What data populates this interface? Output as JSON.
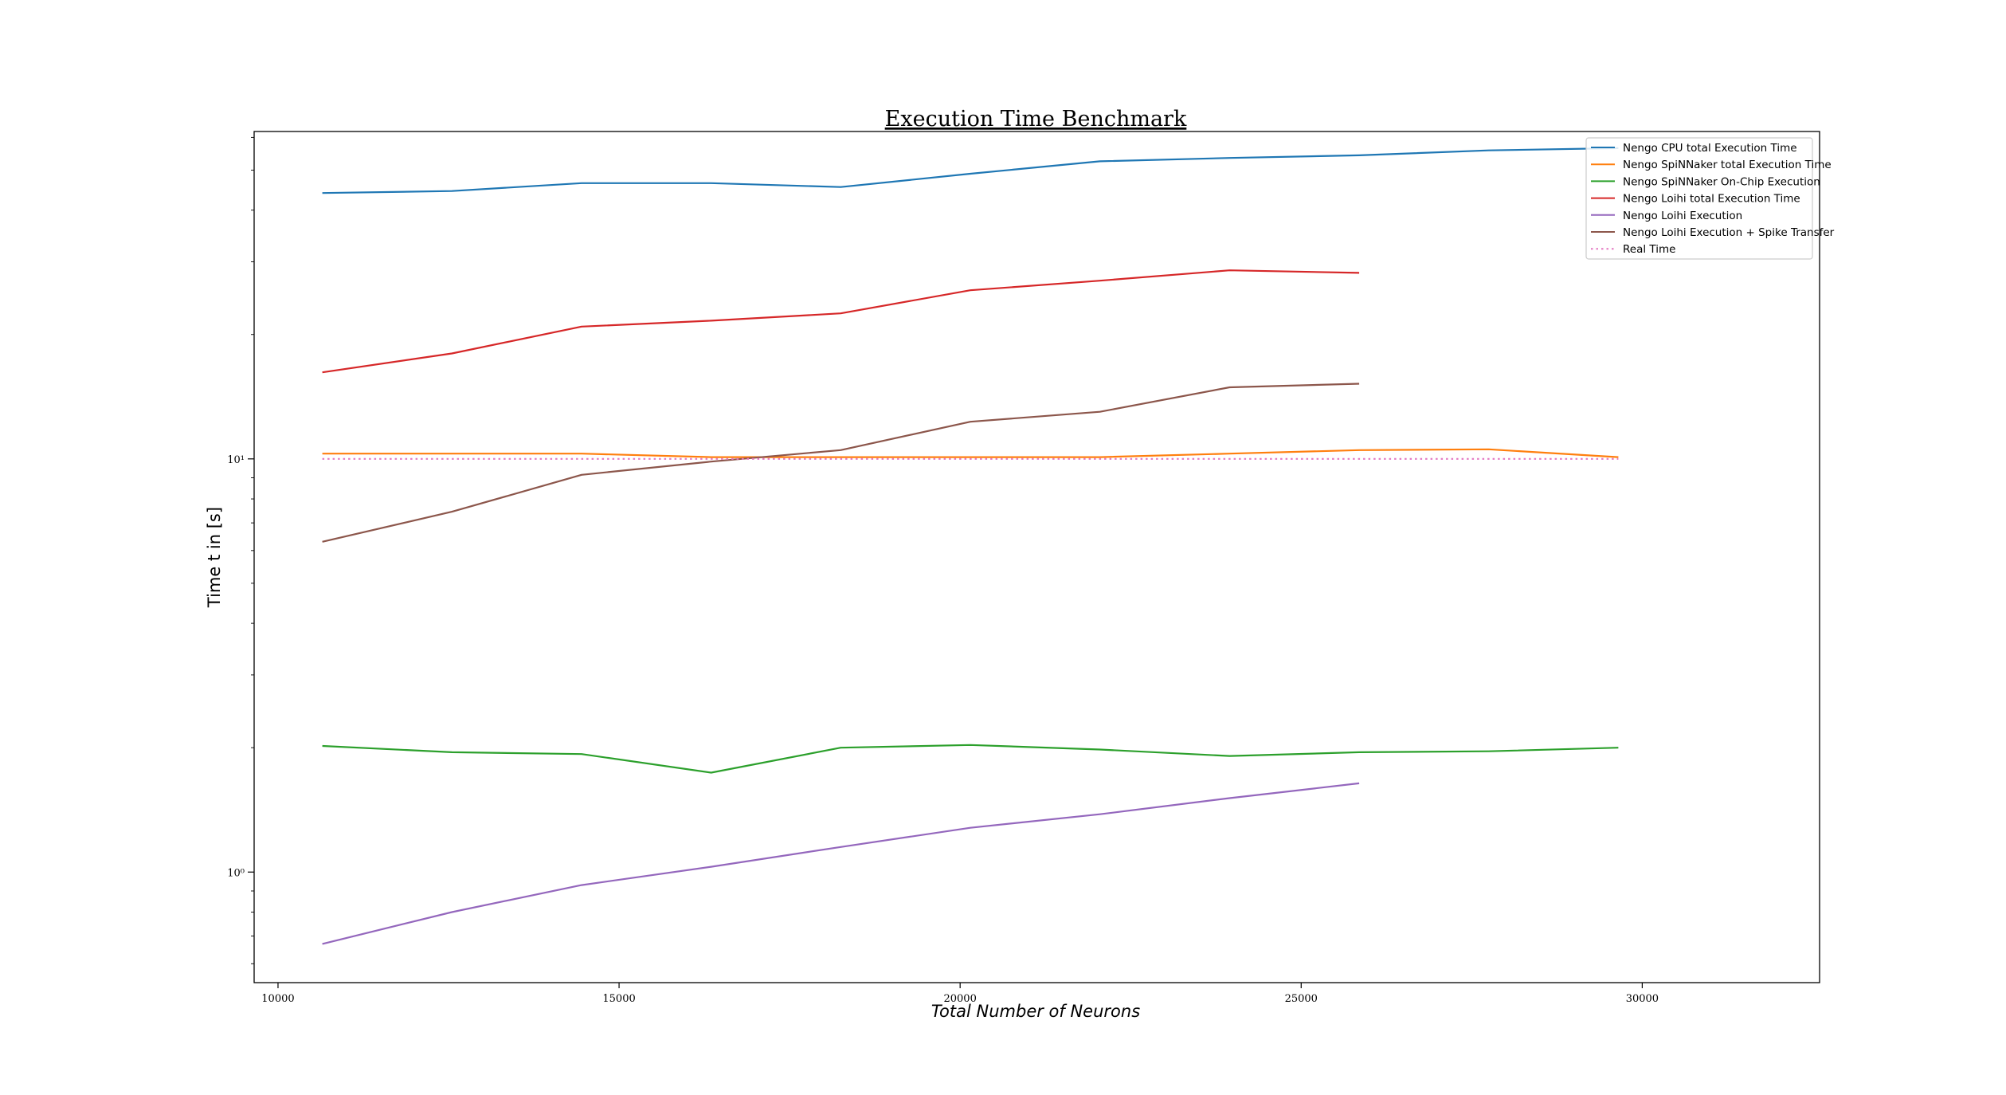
{
  "chart_data": {
    "type": "line",
    "title": "Execution Time Benchmark",
    "xlabel": "Total Number of Neurons",
    "ylabel": "Time t in [s]",
    "xlim": [
      9650,
      32600
    ],
    "ylim": [
      0.54,
      62
    ],
    "yscale": "log",
    "grid": false,
    "legend_position": "top-right",
    "x_ticks": [
      10000,
      15000,
      20000,
      25000,
      30000
    ],
    "y_ticks": [
      {
        "value": 1,
        "label": "10⁰"
      },
      {
        "value": 10,
        "label": "10¹"
      }
    ],
    "series": [
      {
        "name": "Nengo CPU total Execution Time",
        "color": "#1f77b4",
        "style": "solid",
        "x": [
          10650,
          12550,
          14450,
          16350,
          18250,
          20150,
          22050,
          23950,
          25850,
          27750,
          29650
        ],
        "y": [
          44,
          44.5,
          46.5,
          46.5,
          45.5,
          49,
          52.5,
          53.5,
          54.3,
          55.8,
          56.5
        ]
      },
      {
        "name": "Nengo SpiNNaker total Execution Time",
        "color": "#ff7f0e",
        "style": "solid",
        "x": [
          10650,
          12550,
          14450,
          16350,
          18250,
          20150,
          22050,
          23950,
          25850,
          27750,
          29650
        ],
        "y": [
          10.3,
          10.3,
          10.3,
          10.1,
          10.1,
          10.1,
          10.1,
          10.3,
          10.5,
          10.55,
          10.1
        ]
      },
      {
        "name": "Nengo SpiNNaker On-Chip Execution",
        "color": "#2ca02c",
        "style": "solid",
        "x": [
          10650,
          12550,
          14450,
          16350,
          18250,
          20150,
          22050,
          23950,
          25850,
          27750,
          29650
        ],
        "y": [
          2.02,
          1.95,
          1.93,
          1.74,
          2.0,
          2.03,
          1.98,
          1.91,
          1.95,
          1.96,
          2.0
        ]
      },
      {
        "name": "Nengo Loihi total Execution Time",
        "color": "#d62728",
        "style": "solid",
        "x": [
          10650,
          12550,
          14450,
          16350,
          18250,
          20150,
          22050,
          23950,
          25850
        ],
        "y": [
          16.2,
          18.0,
          20.9,
          21.6,
          22.5,
          25.6,
          27.0,
          28.6,
          28.2
        ]
      },
      {
        "name": "Nengo Loihi Execution",
        "color": "#9467bd",
        "style": "solid",
        "x": [
          10650,
          12550,
          14450,
          16350,
          18250,
          20150,
          22050,
          23950,
          25850
        ],
        "y": [
          0.67,
          0.8,
          0.93,
          1.03,
          1.15,
          1.28,
          1.38,
          1.51,
          1.64
        ]
      },
      {
        "name": "Nengo Loihi Execution + Spike Transfer",
        "color": "#8c564b",
        "style": "solid",
        "x": [
          10650,
          12550,
          14450,
          16350,
          18250,
          20150,
          22050,
          23950,
          25850
        ],
        "y": [
          6.3,
          7.45,
          9.15,
          9.85,
          10.5,
          12.3,
          13.0,
          14.9,
          15.2
        ]
      },
      {
        "name": "Real Time",
        "color": "#e377c2",
        "style": "dotted",
        "x": [
          10650,
          29650
        ],
        "y": [
          10,
          10
        ]
      }
    ]
  }
}
